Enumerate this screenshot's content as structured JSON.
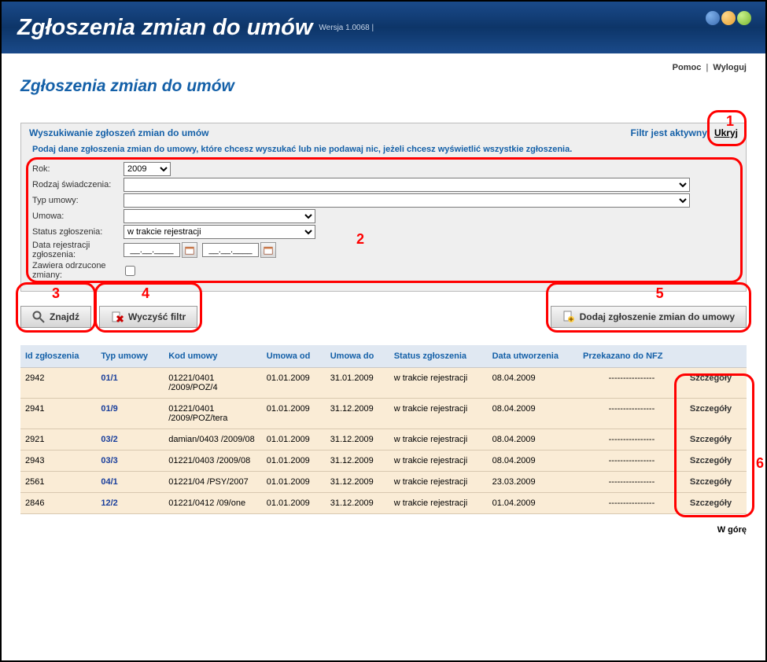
{
  "header": {
    "title": "Zgłoszenia zmian do umów",
    "version": "Wersja 1.0068 |"
  },
  "topLinks": {
    "help": "Pomoc",
    "logout": "Wyloguj"
  },
  "page_heading": "Zgłoszenia zmian do umów",
  "search": {
    "panel_title": "Wyszukiwanie zgłoszeń zmian do umów",
    "filter_active": "Filtr jest aktywny",
    "hide": "Ukryj",
    "instruction": "Podaj dane zgłoszenia zmian do umowy, które chcesz wyszukać lub nie podawaj nic, jeżeli chcesz wyświetlić wszystkie zgłoszenia.",
    "labels": {
      "rok": "Rok:",
      "rodzaj": "Rodzaj świadczenia:",
      "typ": "Typ umowy:",
      "umowa": "Umowa:",
      "status": "Status zgłoszenia:",
      "data_rej": "Data rejestracji zgłoszenia:",
      "zawiera": "Zawiera odrzucone zmiany:"
    },
    "values": {
      "rok": "2009",
      "rodzaj": "",
      "typ": "",
      "umowa": "",
      "status": "w trakcie rejestracji",
      "date_from": "__.__.____",
      "date_to": "__.__.____"
    }
  },
  "buttons": {
    "find": "Znajdź",
    "clear": "Wyczyść filtr",
    "add": "Dodaj zgłoszenie zmian do umowy"
  },
  "table": {
    "headers": {
      "id": "Id zgłoszenia",
      "typ": "Typ umowy",
      "kod": "Kod umowy",
      "od": "Umowa od",
      "do": "Umowa do",
      "status": "Status zgłoszenia",
      "data": "Data utworzenia",
      "nfz": "Przekazano do NFZ",
      "details": ""
    },
    "rows": [
      {
        "id": "2942",
        "typ": "01/1",
        "kod": "01221/0401 /2009/POZ/4",
        "od": "01.01.2009",
        "do": "31.01.2009",
        "status": "w trakcie rejestracji",
        "data": "08.04.2009",
        "nfz": "----------------",
        "details": "Szczegóły"
      },
      {
        "id": "2941",
        "typ": "01/9",
        "kod": "01221/0401 /2009/POZ/tera",
        "od": "01.01.2009",
        "do": "31.12.2009",
        "status": "w trakcie rejestracji",
        "data": "08.04.2009",
        "nfz": "----------------",
        "details": "Szczegóły"
      },
      {
        "id": "2921",
        "typ": "03/2",
        "kod": "damian/0403 /2009/08",
        "od": "01.01.2009",
        "do": "31.12.2009",
        "status": "w trakcie rejestracji",
        "data": "08.04.2009",
        "nfz": "----------------",
        "details": "Szczegóły"
      },
      {
        "id": "2943",
        "typ": "03/3",
        "kod": "01221/0403 /2009/08",
        "od": "01.01.2009",
        "do": "31.12.2009",
        "status": "w trakcie rejestracji",
        "data": "08.04.2009",
        "nfz": "----------------",
        "details": "Szczegóły"
      },
      {
        "id": "2561",
        "typ": "04/1",
        "kod": "01221/04 /PSY/2007",
        "od": "01.01.2009",
        "do": "31.12.2009",
        "status": "w trakcie rejestracji",
        "data": "23.03.2009",
        "nfz": "----------------",
        "details": "Szczegóły"
      },
      {
        "id": "2846",
        "typ": "12/2",
        "kod": "01221/0412 /09/one",
        "od": "01.01.2009",
        "do": "31.12.2009",
        "status": "w trakcie rejestracji",
        "data": "01.04.2009",
        "nfz": "----------------",
        "details": "Szczegóły"
      }
    ]
  },
  "footer": {
    "up": "W górę"
  },
  "annotations": {
    "n1": "1",
    "n2": "2",
    "n3": "3",
    "n4": "4",
    "n5": "5",
    "n6": "6"
  }
}
